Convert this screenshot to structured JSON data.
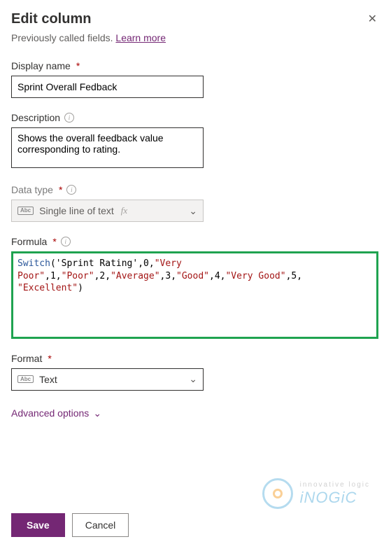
{
  "header": {
    "title": "Edit column",
    "subtitle_prefix": "Previously called fields. ",
    "learn_more": "Learn more"
  },
  "display_name": {
    "label": "Display name",
    "value": "Sprint Overall Fedback"
  },
  "description": {
    "label": "Description",
    "value": "Shows the overall feedback value corresponding to rating."
  },
  "data_type": {
    "label": "Data type",
    "value": "Single line of text"
  },
  "formula": {
    "label": "Formula",
    "fn": "Switch",
    "field_ref": "'Sprint Rating'",
    "pairs": [
      {
        "k": "0",
        "v": "\"Very Poor\""
      },
      {
        "k": "1",
        "v": "\"Poor\""
      },
      {
        "k": "2",
        "v": "\"Average\""
      },
      {
        "k": "3",
        "v": "\"Good\""
      },
      {
        "k": "4",
        "v": "\"Very Good\""
      },
      {
        "k": "5",
        "v": "\"Excellent\""
      }
    ]
  },
  "format": {
    "label": "Format",
    "value": "Text"
  },
  "advanced": "Advanced options",
  "buttons": {
    "save": "Save",
    "cancel": "Cancel"
  },
  "watermark": {
    "tagline": "innovative logic",
    "brand": "iNOGiC"
  }
}
